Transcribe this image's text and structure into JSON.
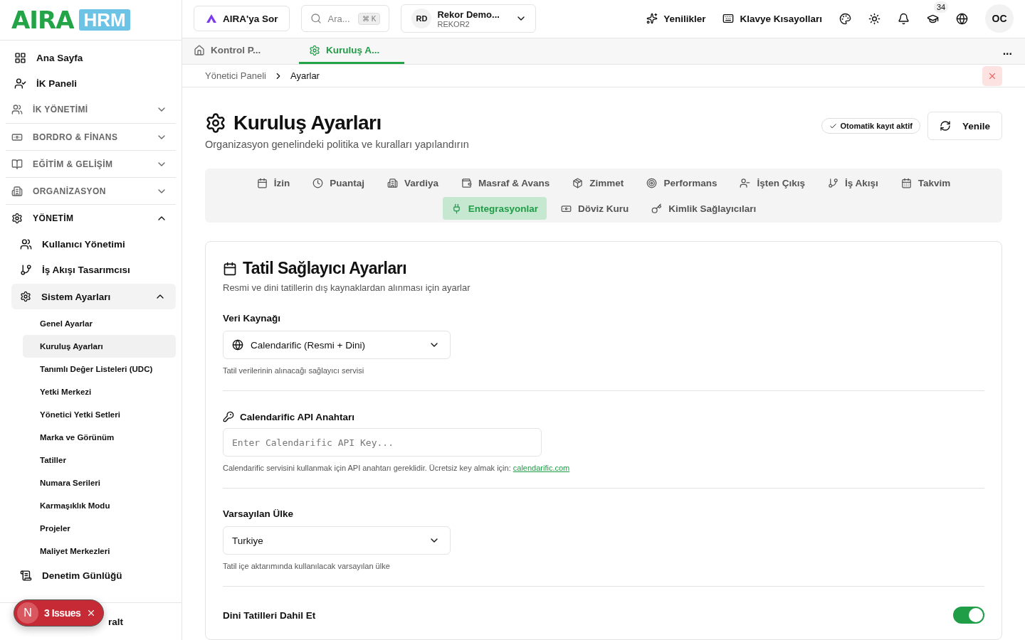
{
  "logo": {
    "word": "AIRA",
    "badge": "HRM"
  },
  "sidebar": {
    "items": [
      {
        "kind": "link",
        "label": "Ana Sayfa"
      },
      {
        "kind": "link",
        "label": "İK Paneli"
      },
      {
        "kind": "section",
        "label": "İK YÖNETİMİ",
        "expanded": false
      },
      {
        "kind": "section",
        "label": "BORDRO & FİNANS",
        "expanded": false
      },
      {
        "kind": "section",
        "label": "EĞİTİM & GELİŞİM",
        "expanded": false
      },
      {
        "kind": "section",
        "label": "ORGANİZASYON",
        "expanded": false
      },
      {
        "kind": "section",
        "label": "YÖNETİM",
        "expanded": true,
        "children": [
          {
            "kind": "link",
            "label": "Kullanıcı Yönetimi"
          },
          {
            "kind": "link",
            "label": "İş Akışı Tasarımcısı"
          },
          {
            "kind": "group",
            "label": "Sistem Ayarları",
            "expanded": true,
            "children": [
              {
                "label": "Genel Ayarlar",
                "selected": false
              },
              {
                "label": "Kuruluş Ayarları",
                "selected": true
              },
              {
                "label": "Tanımlı Değer Listeleri (UDC)",
                "selected": false
              },
              {
                "label": "Yetki Merkezi",
                "selected": false
              },
              {
                "label": "Yönetici Yetki Setleri",
                "selected": false
              },
              {
                "label": "Marka ve Görünüm",
                "selected": false
              },
              {
                "label": "Tatiller",
                "selected": false
              },
              {
                "label": "Numara Serileri",
                "selected": false
              },
              {
                "label": "Karmaşıklık Modu",
                "selected": false
              },
              {
                "label": "Projeler",
                "selected": false
              },
              {
                "label": "Maliyet Merkezleri",
                "selected": false
              }
            ]
          },
          {
            "kind": "link",
            "label": "Denetim Günlüğü"
          }
        ]
      }
    ],
    "footer": "ralt"
  },
  "issues_badge": {
    "letter": "N",
    "label": "3 Issues"
  },
  "header": {
    "ask": "AIRA'ya Sor",
    "search": {
      "placeholder": "Ara...",
      "shortcut": "⌘ K"
    },
    "company": {
      "initials": "RD",
      "name": "Rekor Demo...",
      "code": "REKOR2"
    },
    "whats_new": "Yenilikler",
    "shortcuts": "Klavye Kısayolları",
    "course_count": "34",
    "avatar": "OC"
  },
  "page_tabs": [
    {
      "label": "Kontrol P...",
      "selected": false
    },
    {
      "label": "Kuruluş A...",
      "selected": true
    }
  ],
  "more": "...",
  "breadcrumb": [
    "Yönetici Paneli",
    "Ayarlar"
  ],
  "title": "Kuruluş Ayarları",
  "subtitle": "Organizasyon genelindeki politika ve kuralları yapılandırın",
  "autosave": "Otomatik kayıt aktif",
  "refresh": "Yenile",
  "settings_tabs": [
    {
      "label": "İzin",
      "selected": false
    },
    {
      "label": "Puantaj",
      "selected": false
    },
    {
      "label": "Vardiya",
      "selected": false
    },
    {
      "label": "Masraf & Avans",
      "selected": false
    },
    {
      "label": "Zimmet",
      "selected": false
    },
    {
      "label": "Performans",
      "selected": false
    },
    {
      "label": "İşten Çıkış",
      "selected": false
    },
    {
      "label": "İş Akışı",
      "selected": false
    },
    {
      "label": "Takvim",
      "selected": false
    },
    {
      "label": "Entegrasyonlar",
      "selected": true
    },
    {
      "label": "Döviz Kuru",
      "selected": false
    },
    {
      "label": "Kimlik Sağlayıcıları",
      "selected": false
    }
  ],
  "card": {
    "title": "Tatil Sağlayıcı Ayarları",
    "subtitle": "Resmi ve dini tatillerin dış kaynaklardan alınması için ayarlar",
    "fields": [
      {
        "kind": "select",
        "label": "Veri Kaynağı",
        "value": "Calendarific (Resmi + Dini)",
        "help": "Tatil verilerinin alınacağı sağlayıcı servisi"
      },
      {
        "kind": "input",
        "label": "Calendarific API Anahtarı",
        "placeholder": "Enter Calendarific API Key...",
        "help": "Calendarific servisini kullanmak için API anahtarı gereklidir. Ücretsiz key almak için: ",
        "link": "calendarific.com"
      },
      {
        "kind": "select",
        "label": "Varsayılan Ülke",
        "value": "Turkiye",
        "help": "Tatil içe aktarımında kullanılacak varsayılan ülke"
      },
      {
        "kind": "toggle",
        "label": "Dini Tatilleri Dahil Et",
        "on": true
      }
    ]
  }
}
